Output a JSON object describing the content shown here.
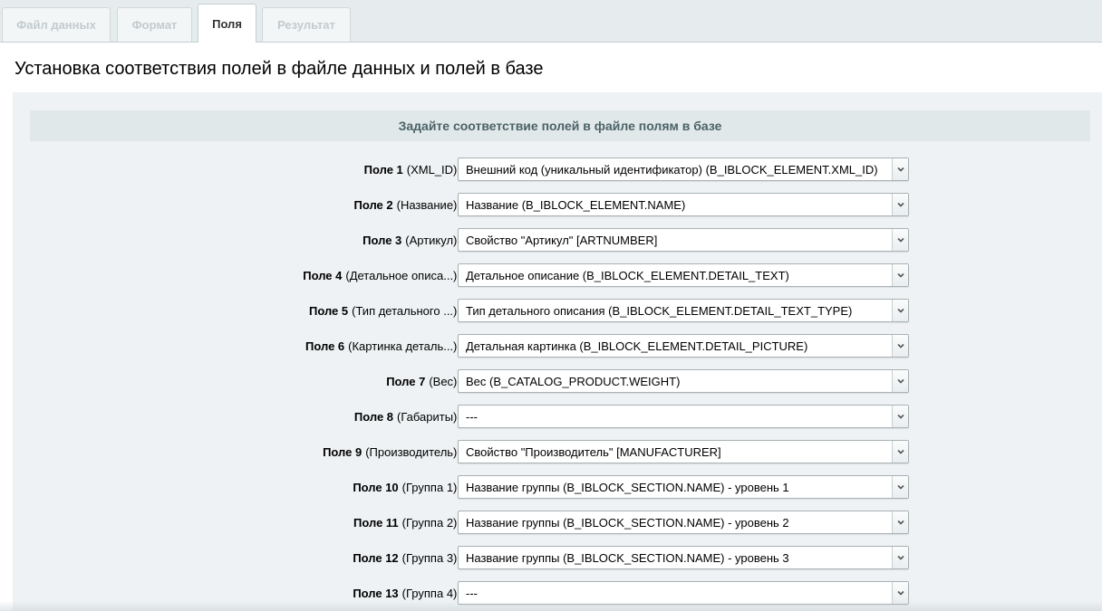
{
  "tabs": [
    {
      "label": "Файл данных",
      "active": false
    },
    {
      "label": "Формат",
      "active": false
    },
    {
      "label": "Поля",
      "active": true
    },
    {
      "label": "Результат",
      "active": false
    }
  ],
  "page_title": "Установка соответствия полей в файле данных и полей в базе",
  "section_title": "Задайте соответствие полей в файле полям в базе",
  "fields": [
    {
      "num": "Поле 1",
      "name": "(XML_ID):",
      "value": "Внешний код (уникальный идентификатор) (B_IBLOCK_ELEMENT.XML_ID)"
    },
    {
      "num": "Поле 2",
      "name": "(Название):",
      "value": "Название (B_IBLOCK_ELEMENT.NAME)"
    },
    {
      "num": "Поле 3",
      "name": "(Артикул):",
      "value": "Свойство \"Артикул\" [ARTNUMBER]"
    },
    {
      "num": "Поле 4",
      "name": "(Детальное описа...):",
      "value": "Детальное описание (B_IBLOCK_ELEMENT.DETAIL_TEXT)"
    },
    {
      "num": "Поле 5",
      "name": "(Тип детального ...):",
      "value": "Тип детального описания (B_IBLOCK_ELEMENT.DETAIL_TEXT_TYPE)"
    },
    {
      "num": "Поле 6",
      "name": "(Картинка деталь...):",
      "value": "Детальная картинка (B_IBLOCK_ELEMENT.DETAIL_PICTURE)"
    },
    {
      "num": "Поле 7",
      "name": "(Вес):",
      "value": "Вес (B_CATALOG_PRODUCT.WEIGHT)"
    },
    {
      "num": "Поле 8",
      "name": "(Габариты):",
      "value": "---"
    },
    {
      "num": "Поле 9",
      "name": "(Производитель):",
      "value": "Свойство \"Производитель\" [MANUFACTURER]"
    },
    {
      "num": "Поле 10",
      "name": "(Группа 1):",
      "value": "Название группы (B_IBLOCK_SECTION.NAME) - уровень 1"
    },
    {
      "num": "Поле 11",
      "name": "(Группа 2):",
      "value": "Название группы (B_IBLOCK_SECTION.NAME) - уровень 2"
    },
    {
      "num": "Поле 12",
      "name": "(Группа 3):",
      "value": "Название группы (B_IBLOCK_SECTION.NAME) - уровень 3"
    },
    {
      "num": "Поле 13",
      "name": "(Группа 4):",
      "value": "---"
    }
  ],
  "icons": {
    "dropdown": "chevron-down-icon"
  }
}
